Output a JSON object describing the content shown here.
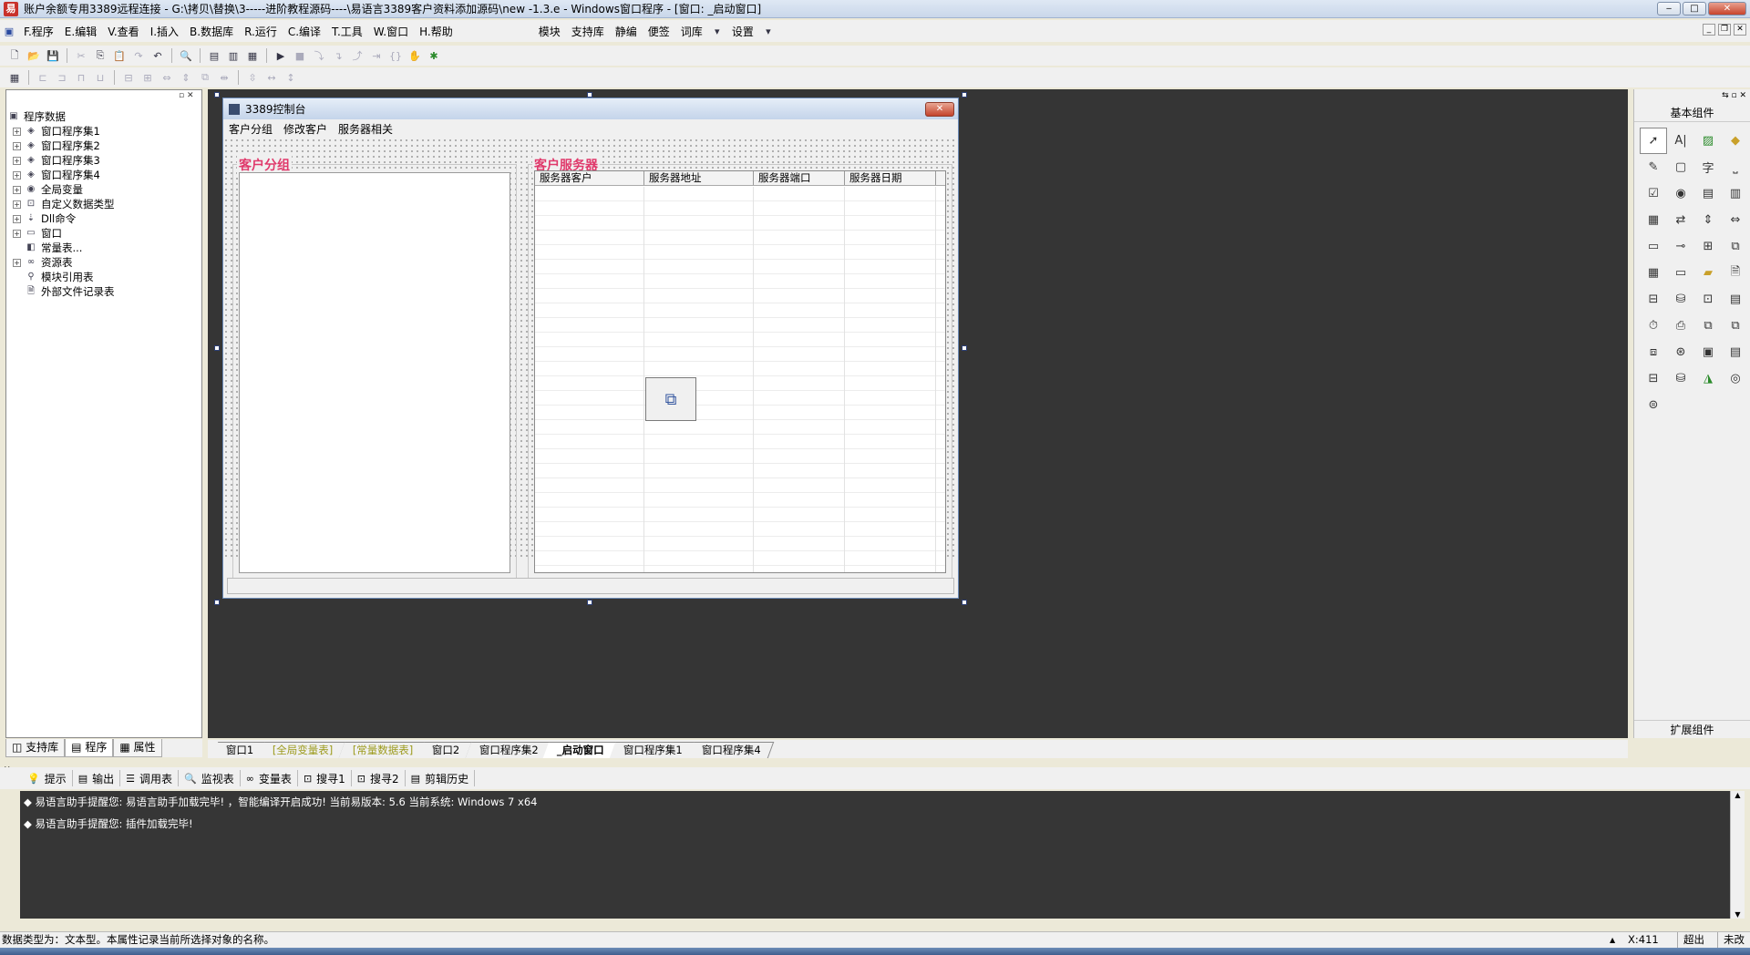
{
  "window": {
    "title": "账户余额专用3389远程连接 - G:\\拷贝\\替换\\3-----进阶教程源码----\\易语言3389客户资料添加源码\\new -1.3.e - Windows窗口程序 - [窗口: _启动窗口]",
    "btn_min": "‒",
    "btn_max": "□",
    "btn_close": "✕"
  },
  "menubar": {
    "items": [
      "F.程序",
      "E.编辑",
      "V.查看",
      "I.插入",
      "B.数据库",
      "R.运行",
      "C.编译",
      "T.工具",
      "W.窗口",
      "H.帮助"
    ],
    "extra": [
      "模块",
      "支持库",
      "静编",
      "便签",
      "词库",
      "设置"
    ]
  },
  "left_panel": {
    "root": "程序数据",
    "items": [
      "窗口程序集1",
      "窗口程序集2",
      "窗口程序集3",
      "窗口程序集4",
      "全局变量",
      "自定义数据类型",
      "Dll命令",
      "窗口",
      "常量表...",
      "资源表",
      "模块引用表",
      "外部文件记录表"
    ],
    "tabs": [
      "支持库",
      "程序",
      "属性"
    ]
  },
  "form": {
    "title": "3389控制台",
    "menu": [
      "客户分组",
      "修改客户",
      "服务器相关"
    ],
    "group_left": "客户分组",
    "group_right": "客户服务器",
    "columns": [
      "服务器客户",
      "服务器地址",
      "服务器端口",
      "服务器日期"
    ]
  },
  "right_panel": {
    "title": "基本组件",
    "footer": "扩展组件"
  },
  "doc_tabs": [
    "窗口1",
    "[全局变量表]",
    "[常量数据表]",
    "窗口2",
    "窗口程序集2",
    "_启动窗口",
    "窗口程序集1",
    "窗口程序集4"
  ],
  "output_tabs": [
    "提示",
    "输出",
    "调用表",
    "监视表",
    "变量表",
    "搜寻1",
    "搜寻2",
    "剪辑历史"
  ],
  "output_lines": [
    "易语言助手提醒您: 易语言助手加载完毕! ，智能编译开启成功! 当前易版本: 5.6  当前系统: Windows 7 x64",
    "易语言助手提醒您: 插件加载完毕!"
  ],
  "status": {
    "text": "数据类型为：文本型。本属性记录当前所选择对象的名称。",
    "coord": "X:411",
    "mode1": "超出",
    "mode2": "未改"
  },
  "colors": {
    "designer_bg": "#353535",
    "group_caption": "#e0396b",
    "output_bg": "#363636"
  }
}
